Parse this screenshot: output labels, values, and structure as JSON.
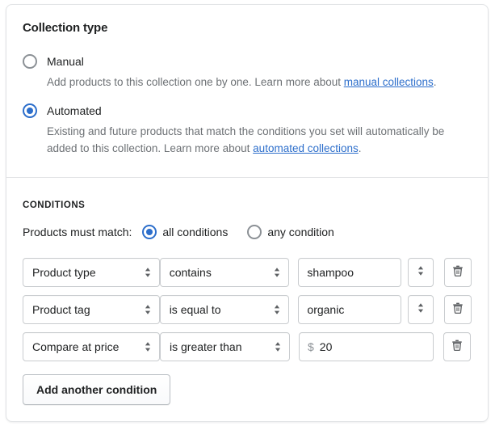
{
  "card": {
    "title": "Collection type",
    "collection_types": [
      {
        "label": "Manual",
        "selected": false,
        "help_before": "Add products to this collection one by one. Learn more about ",
        "help_link": "manual collections",
        "help_after": "."
      },
      {
        "label": "Automated",
        "selected": true,
        "help_before": "Existing and future products that match the conditions you set will automatically be added to this collection. Learn more about ",
        "help_link": "automated collections",
        "help_after": "."
      }
    ]
  },
  "conditions": {
    "heading": "CONDITIONS",
    "match_label": "Products must match:",
    "match_options": [
      {
        "label": "all conditions",
        "selected": true
      },
      {
        "label": "any condition",
        "selected": false
      }
    ],
    "rows": [
      {
        "subject": "Product type",
        "operator": "contains",
        "value": "shampoo",
        "prefix": "",
        "has_stepper": true,
        "delete_label": "delete-condition"
      },
      {
        "subject": "Product tag",
        "operator": "is equal to",
        "value": "organic",
        "prefix": "",
        "has_stepper": true,
        "delete_label": "delete-condition"
      },
      {
        "subject": "Compare at price",
        "operator": "is greater than",
        "value": "20",
        "prefix": "$",
        "has_stepper": false,
        "delete_label": "delete-condition"
      }
    ],
    "add_button": "Add another condition"
  },
  "icons": {
    "select_stepper": "stepper-chevrons-icon",
    "value_stepper": "stepper-chevrons-icon",
    "trash": "trash-icon"
  },
  "colors": {
    "accent": "#2c6ecb",
    "text": "#202223",
    "subdued": "#6d7175",
    "border": "#c9cccf",
    "divider": "#e1e3e5"
  }
}
